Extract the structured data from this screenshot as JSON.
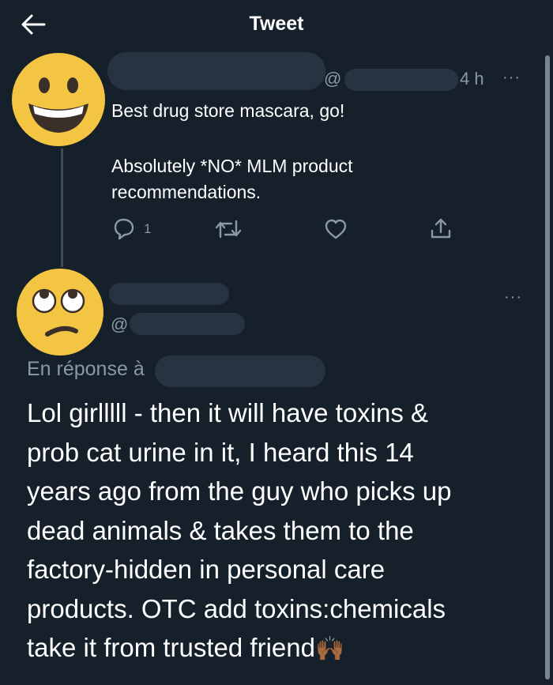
{
  "header": {
    "title": "Tweet",
    "back_icon": "arrow-left-icon"
  },
  "original_tweet": {
    "avatar": "grinning-emoji-avatar",
    "handle_prefix": "@",
    "time": "4 h",
    "more": "···",
    "text_line1": "Best drug store mascara, go!",
    "text_line2": "Absolutely *NO* MLM product",
    "text_line3": "recommendations.",
    "reply_count": "1",
    "actions": [
      "reply-icon",
      "retweet-icon",
      "like-icon",
      "share-icon"
    ]
  },
  "reply_tweet": {
    "avatar": "eye-roll-emoji-avatar",
    "handle_prefix": "@",
    "more": "···",
    "replying_to_label": "En réponse à",
    "lines": [
      "Lol girlllll - then it will have toxins &",
      "prob cat urine in it, I heard this 14",
      "years ago from the guy who picks up",
      "dead animals & takes them to the",
      "factory-hidden in personal care",
      "products. OTC add toxins:chemicals",
      "take it from trusted friend"
    ],
    "trailing_emoji": "🙌🏾"
  },
  "colors": {
    "background": "#15202b",
    "text": "#ffffff",
    "muted": "#8b98a5",
    "redaction": "#273340",
    "emoji_yellow": "#f4c542"
  }
}
